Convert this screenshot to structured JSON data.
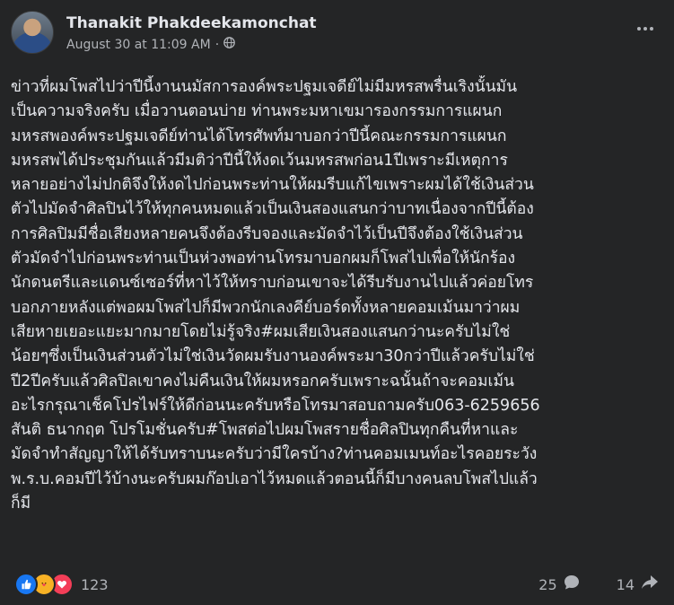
{
  "post": {
    "author": "Thanakit Phakdeekamonchat",
    "timestamp": "August 30 at 11:09 AM",
    "separator": "·",
    "audience_icon": "globe-icon",
    "more_icon": "more-options-icon",
    "lines": [
      "ข่าวที่ผมโพสไปว่าปีนี้งานนมัสการองค์พระปฐมเจดีย์ไม่มีมหรสพรื่นเริงนั้นมัน",
      "เป็นความจริงครับ เมื่อวานตอนบ่าย ท่านพระมหาเขมารองกรรมการแผนก",
      "มหรสพองค์พระปฐมเจดีย์ท่านได้โทรศัพท์มาบอกว่าปีนี้คณะกรรมการแผนก",
      "มหรสพได้ประชุมกันแล้วมีมติว่าปีนี้ให้งดเว้นมหรสพก่อน1ปีเพราะมีเหตุการ",
      "หลายอย่างไม่ปกติจึงให้งดไปก่อนพระท่านให้ผมรีบแก้ไขเพราะผมได้ใช้เงินส่วน",
      "ตัวไปมัดจำศิลปินไว้ให้ทุกคนหมดแล้วเป็นเงินสองแสนกว่าบาทเนื่องจากปีนี้ต้อง",
      "การศิลปิมมีชื่อเสียงหลายคนจึงต้องรีบจองและมัดจำไว้เป็นปีจึงต้องใช้เงินส่วน",
      "ตัวมัดจำไปก่อนพระท่านเป็นห่วงพอท่านโทรมาบอกผมก็โพสไปเพื่อให้นักร้อง",
      "นักดนตรีและแดนซ์เซอร์ที่หาไว้ให้ทราบก่อนเขาจะได้รีบรับงานไปแล้วค่อยโทร",
      "บอกภายหลังแต่พอผมโพสไปก็มีพวกนักเลงคีย์บอร์ดทั้งหลายคอมเม้นมาว่าผม",
      "เสียหายเยอะแยะมากมายโดยไม่รู้จริง#ผมเสียเงินสองแสนกว่านะครับไม่ใช่",
      "น้อยๆซึ่งเป็นเงินส่วนตัวไม่ใช่เงินวัดผมรับงานองค์พระมา30กว่าปีแล้วครับไม่ใช่",
      "ปี2ปีครับแล้วศิลปิลเขาคงไม่คืนเงินให้ผมหรอกครับเพราะฉนั้นถ้าจะคอมเม้น",
      "อะไรกรุณาเช็คโปรไฟร์ให้ดีก่อนนะครับหรือโทรมาสอบถามครับ063-6259656",
      "สันติ ธนากฤต โปรโมชั่นครับ#โพสต่อไปผมโพสรายชื่อศิลปินทุกคืนที่หาและ",
      "มัดจำทำสัญญาให้ได้รับทราบนะครับว่ามีใครบ้าง?ท่านคอมเมนท์อะไรคอยระวัง",
      "พ.ร.บ.คอมปีไว้บ้างนะครับผมก๊อปเอาไว้หมดแล้วตอนนี้ก็มีบางคนลบโพสไปแล้ว",
      "ก็มี"
    ]
  },
  "footer": {
    "reaction_icons": [
      "like-icon",
      "care-icon",
      "love-icon"
    ],
    "reaction_count": "123",
    "comment_count": "25",
    "share_count": "14"
  },
  "colors": {
    "background": "#242526",
    "text_primary": "#e4e6eb",
    "text_secondary": "#b0b3b8",
    "like_blue": "#1877f2",
    "love_red": "#f33e58",
    "care_yellow": "#f7b125"
  }
}
